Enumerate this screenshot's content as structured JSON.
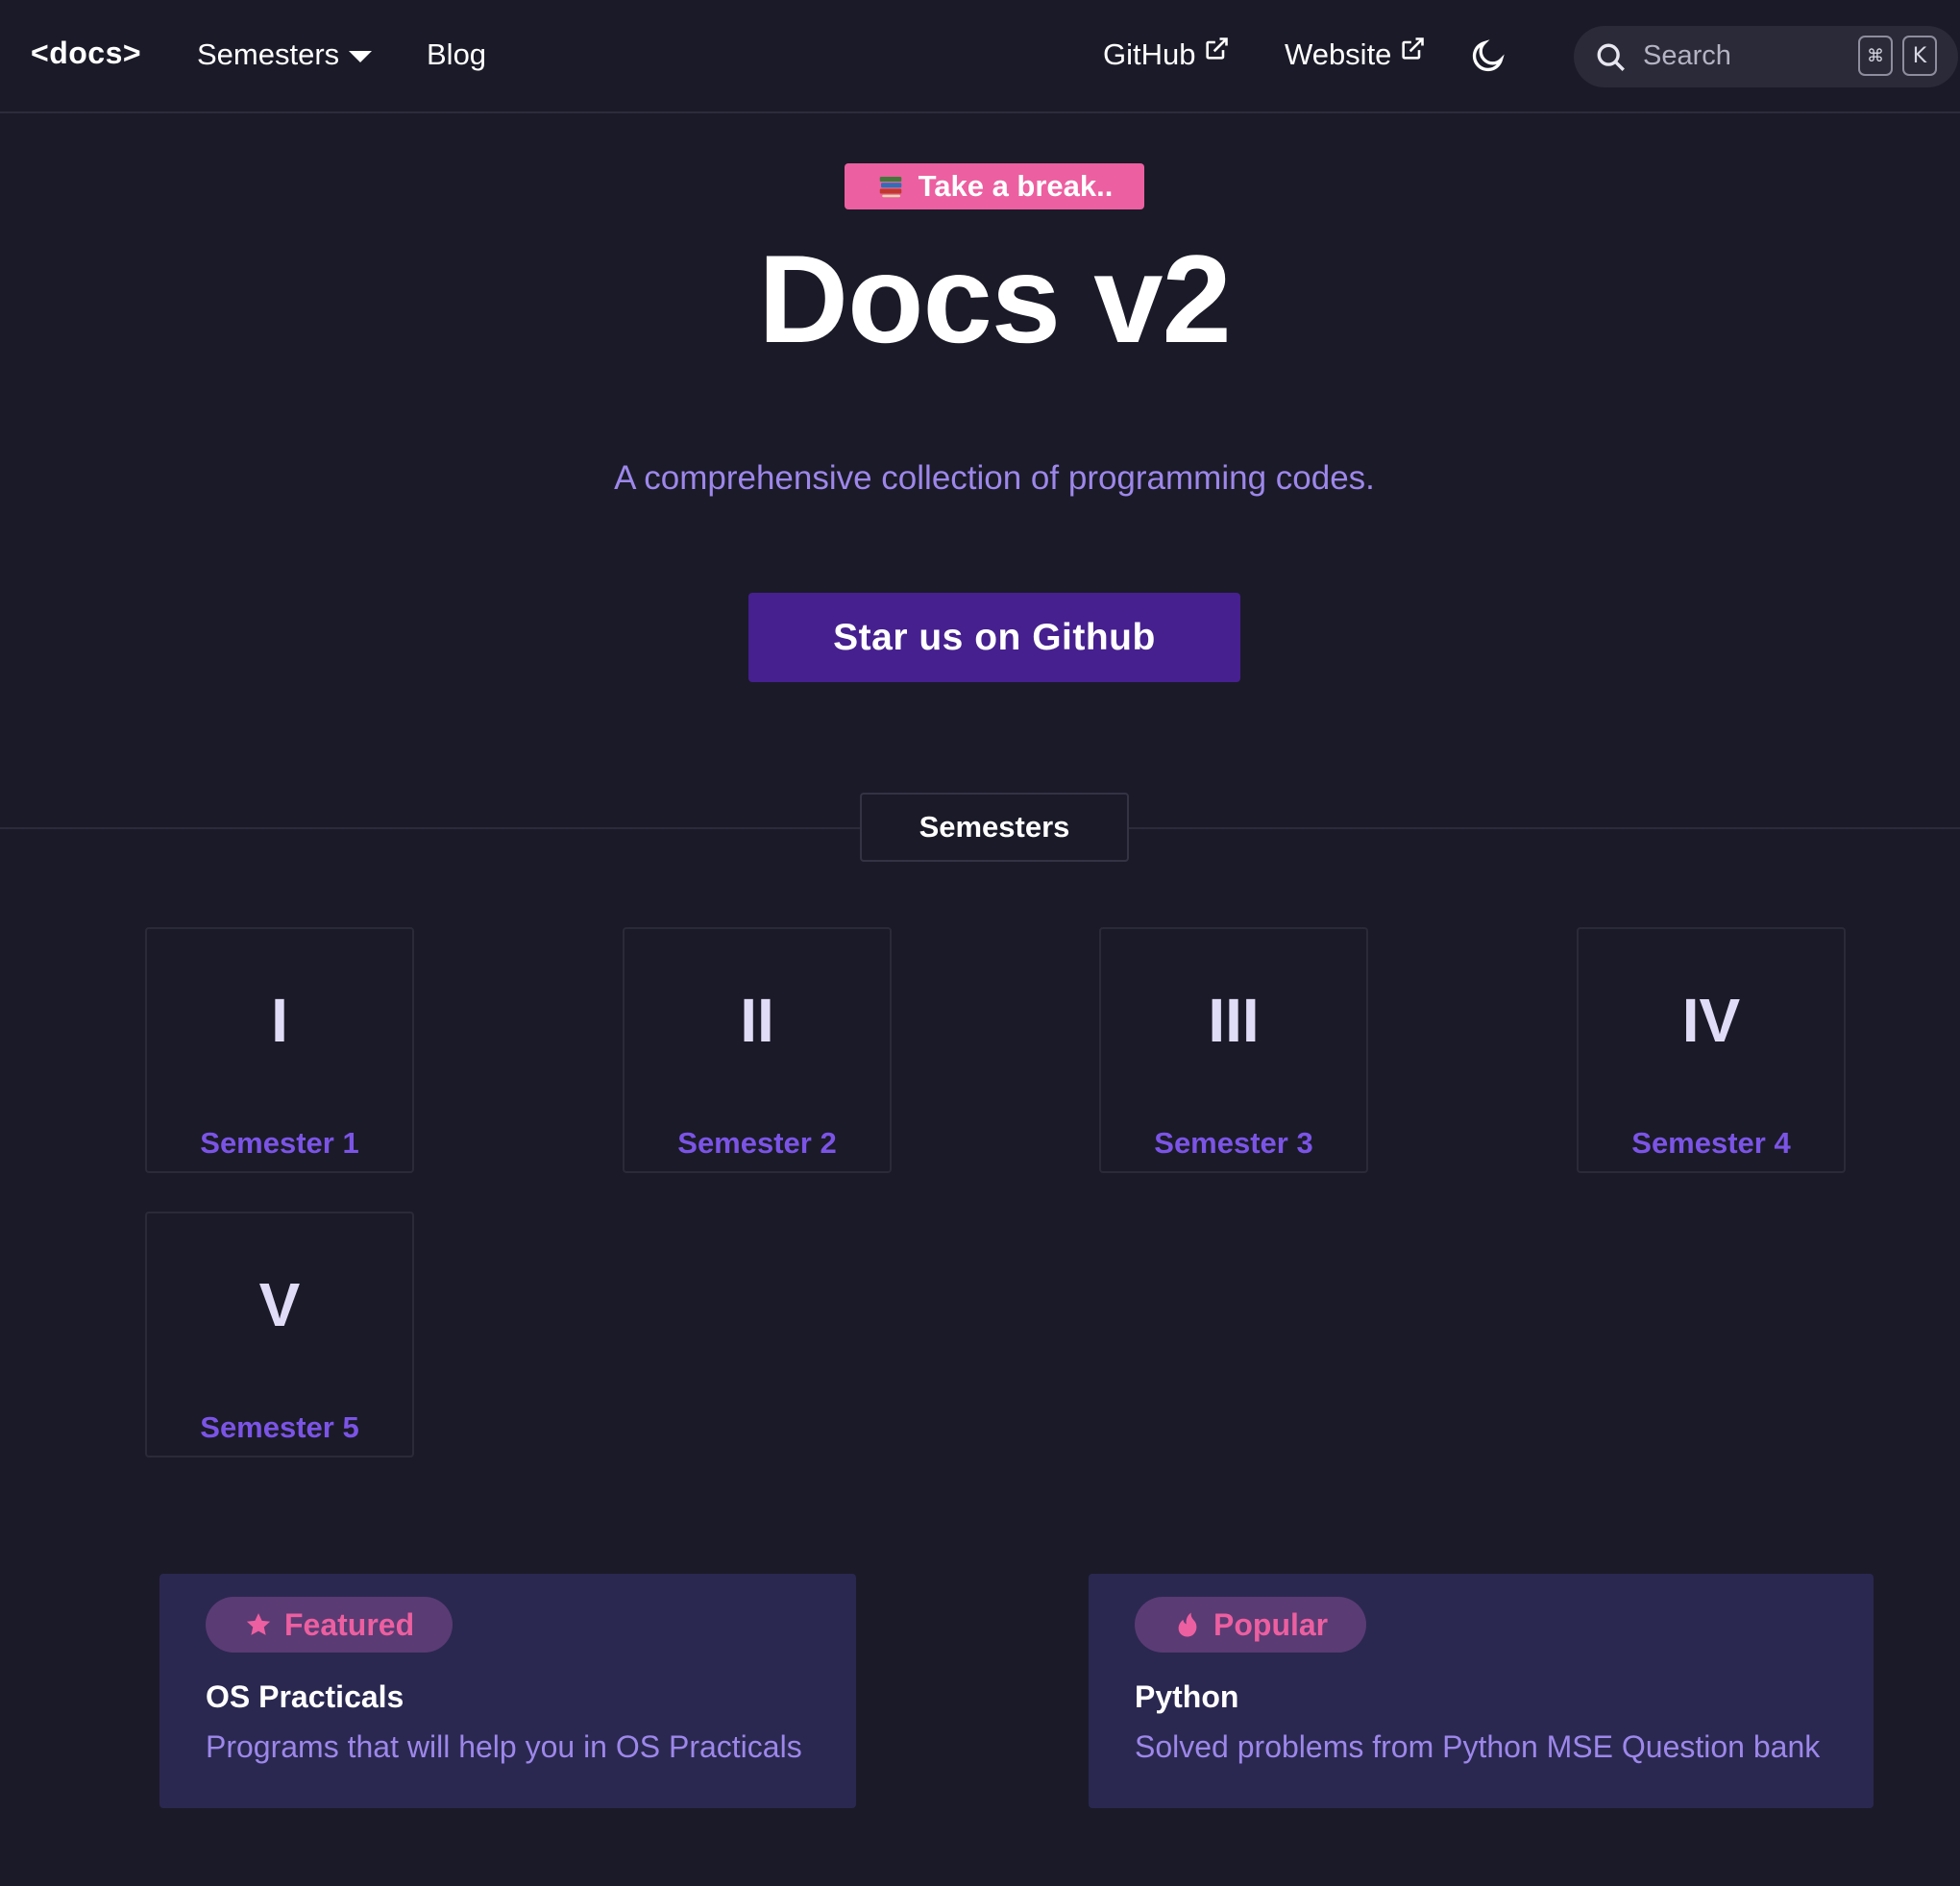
{
  "navbar": {
    "brand": "<docs>",
    "semesters_label": "Semesters",
    "blog_label": "Blog",
    "github_label": "GitHub",
    "website_label": "Website",
    "search_placeholder": "Search",
    "kbd_cmd": "⌘",
    "kbd_k": "K"
  },
  "hero": {
    "pill_text": "Take a break..",
    "title": "Docs v2",
    "subtitle": "A comprehensive collection of programming codes.",
    "cta_label": "Star us on Github"
  },
  "semesters_section": {
    "heading": "Semesters",
    "items": [
      {
        "numeral": "I",
        "label": "Semester 1"
      },
      {
        "numeral": "II",
        "label": "Semester 2"
      },
      {
        "numeral": "III",
        "label": "Semester 3"
      },
      {
        "numeral": "IV",
        "label": "Semester 4"
      },
      {
        "numeral": "V",
        "label": "Semester 5"
      }
    ]
  },
  "features": [
    {
      "badge": "Featured",
      "badge_icon": "star-icon",
      "title": "OS Practicals",
      "description": "Programs that will help you in OS Practicals"
    },
    {
      "badge": "Popular",
      "badge_icon": "fire-icon",
      "title": "Python",
      "description": "Solved problems from Python MSE Question bank"
    }
  ],
  "colors": {
    "background": "#1b1a28",
    "accent_purple": "#7b54e6",
    "cta_purple": "#46208f",
    "pink": "#ec5fa0",
    "card_bg": "#2a2850"
  }
}
